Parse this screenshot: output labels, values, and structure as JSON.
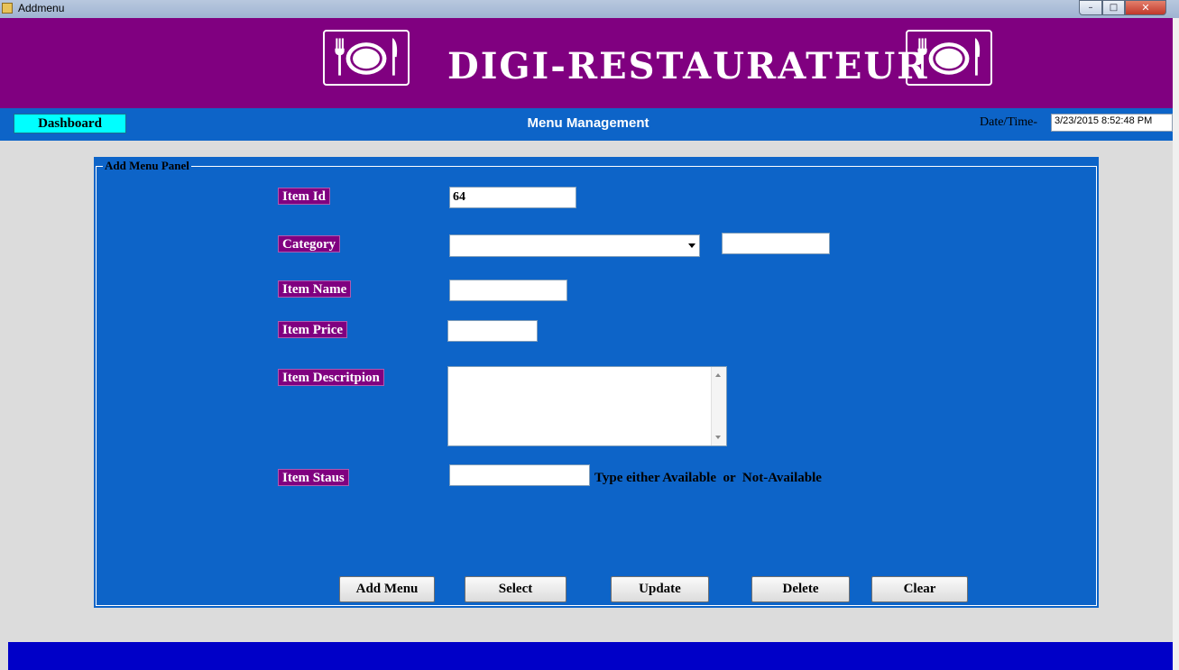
{
  "window": {
    "title": "Addmenu",
    "min_glyph": "–",
    "max_glyph": "□",
    "close_glyph": "✕"
  },
  "header": {
    "brand": "DIGI-RESTAURATEUR",
    "logo_icon": "plate-fork-knife-icon",
    "color": "#800080"
  },
  "navbar": {
    "dashboard_label": "Dashboard",
    "page_title": "Menu Management",
    "datetime_label": "Date/Time-",
    "datetime_value": "3/23/2015 8:52:48 PM",
    "color": "#0d64c8"
  },
  "panel": {
    "legend": "Add Menu Panel",
    "fields": {
      "item_id": {
        "label": "Item Id",
        "value": "64"
      },
      "category": {
        "label": "Category",
        "selected": "",
        "extra_value": ""
      },
      "item_name": {
        "label": "Item Name",
        "value": ""
      },
      "item_price": {
        "label": "Item Price",
        "value": ""
      },
      "item_description": {
        "label": "Item Descritpion",
        "value": ""
      },
      "item_status": {
        "label": "Item Staus",
        "value": "",
        "hint": "Type either Available  or  Not-Available"
      }
    },
    "buttons": {
      "add": "Add Menu",
      "select": "Select",
      "update": "Update",
      "delete": "Delete",
      "clear": "Clear"
    }
  }
}
